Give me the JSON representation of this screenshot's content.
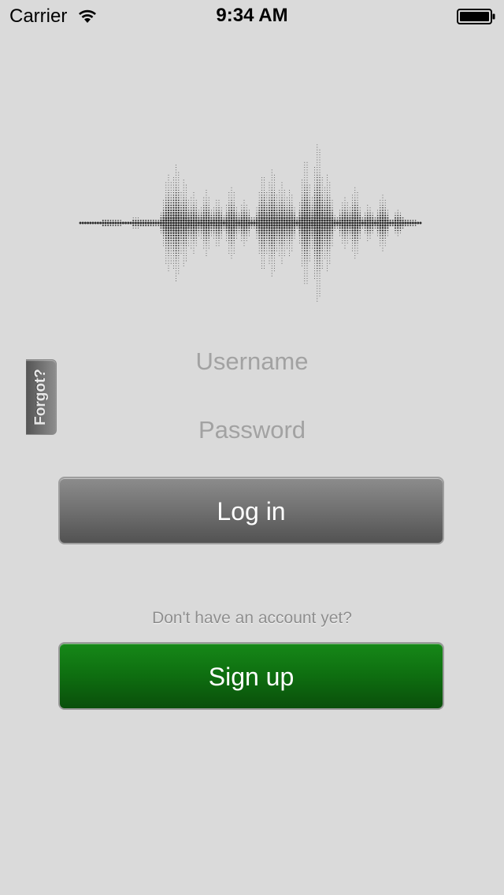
{
  "status_bar": {
    "carrier": "Carrier",
    "time": "9:34 AM",
    "wifi_icon": "wifi-icon",
    "battery_icon": "battery-icon"
  },
  "logo": {
    "icon": "waveform-icon"
  },
  "forgot_tab": {
    "label": "Forgot?"
  },
  "login_form": {
    "username_placeholder": "Username",
    "username_value": "",
    "password_placeholder": "Password",
    "password_value": "",
    "login_label": "Log in"
  },
  "signup": {
    "prompt": "Don't have an account yet?",
    "button_label": "Sign up"
  },
  "colors": {
    "background": "#dadada",
    "login_button": "#707070",
    "signup_button": "#0e6e10"
  }
}
